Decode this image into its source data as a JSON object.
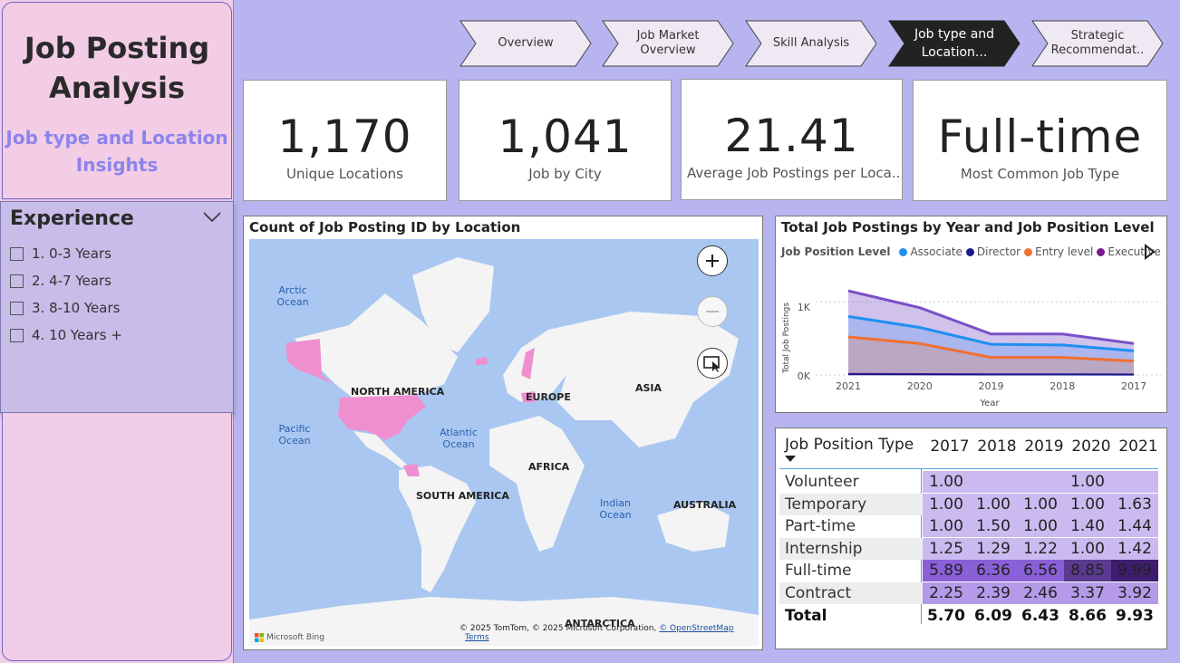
{
  "sidebar": {
    "title": "Job Posting Analysis",
    "subtitle": "Job type and Location Insights",
    "experience": {
      "title": "Experience",
      "items": [
        "1. 0-3 Years",
        "2. 4-7 Years",
        "3. 8-10 Years",
        "4. 10 Years +"
      ]
    }
  },
  "nav": [
    {
      "label": "Overview",
      "active": false
    },
    {
      "label": "Job Market Overview",
      "active": false
    },
    {
      "label": "Skill Analysis",
      "active": false
    },
    {
      "label": "Job type and Location...",
      "active": true
    },
    {
      "label": "Strategic Recommendat..",
      "active": false
    }
  ],
  "kpis": [
    {
      "value": "1,170",
      "label": "Unique Locations"
    },
    {
      "value": "1,041",
      "label": "Job by City"
    },
    {
      "value": "21.41",
      "label": "Average Job Postings per Loca..."
    },
    {
      "value": "Full-time",
      "label": "Most Common Job Type"
    }
  ],
  "map": {
    "title": "Count of Job Posting ID by Location",
    "continents": [
      "NORTH AMERICA",
      "EUROPE",
      "ASIA",
      "AFRICA",
      "SOUTH AMERICA",
      "AUSTRALIA",
      "ANTARCTICA"
    ],
    "oceans": [
      "Arctic Ocean",
      "Pacific Ocean",
      "Atlantic Ocean",
      "Indian Ocean"
    ],
    "brand": "Microsoft Bing",
    "copyright": "© 2025 TomTom, © 2025 Microsoft Corporation,",
    "osm_link": "© OpenStreetMap",
    "terms_link": "Terms",
    "highlight_color": "#f08fd0"
  },
  "area_chart": {
    "title": "Total Job Postings by Year and Job Position Level",
    "legend_title": "Job Position Level",
    "xlabel": "Year",
    "ylabel": "Total Job Postings",
    "yticks": [
      "1K",
      "0K"
    ]
  },
  "chart_data": {
    "type": "area",
    "x": [
      "2021",
      "2020",
      "2019",
      "2018",
      "2017"
    ],
    "ylim": [
      0,
      1300
    ],
    "series": [
      {
        "name": "Associate",
        "color": "#1f8ff0",
        "values": [
          800,
          650,
          420,
          410,
          330
        ]
      },
      {
        "name": "Director",
        "color": "#1a1a8c",
        "values": [
          10,
          8,
          6,
          6,
          5
        ]
      },
      {
        "name": "Entry level",
        "color": "#f07030",
        "values": [
          520,
          430,
          240,
          240,
          190
        ]
      },
      {
        "name": "Executive",
        "color": "#7a1a8c",
        "values": [
          15,
          12,
          10,
          10,
          8
        ]
      },
      {
        "name": "",
        "color": "#7a50c8",
        "values": [
          1150,
          920,
          560,
          560,
          430
        ]
      }
    ]
  },
  "table": {
    "header_label": "Job Position Type",
    "years": [
      "2017",
      "2018",
      "2019",
      "2020",
      "2021"
    ],
    "rows": [
      {
        "name": "Volunteer",
        "values": [
          "1.00",
          "",
          "",
          "1.00",
          ""
        ]
      },
      {
        "name": "Temporary",
        "values": [
          "1.00",
          "1.00",
          "1.00",
          "1.00",
          "1.63"
        ]
      },
      {
        "name": "Part-time",
        "values": [
          "1.00",
          "1.50",
          "1.00",
          "1.40",
          "1.44"
        ]
      },
      {
        "name": "Internship",
        "values": [
          "1.25",
          "1.29",
          "1.22",
          "1.00",
          "1.42"
        ]
      },
      {
        "name": "Full-time",
        "values": [
          "5.89",
          "6.36",
          "6.56",
          "8.85",
          "9.99"
        ]
      },
      {
        "name": "Contract",
        "values": [
          "2.25",
          "2.39",
          "2.46",
          "3.37",
          "3.92"
        ]
      }
    ],
    "total": {
      "name": "Total",
      "values": [
        "5.70",
        "6.09",
        "6.43",
        "8.66",
        "9.93"
      ]
    }
  }
}
